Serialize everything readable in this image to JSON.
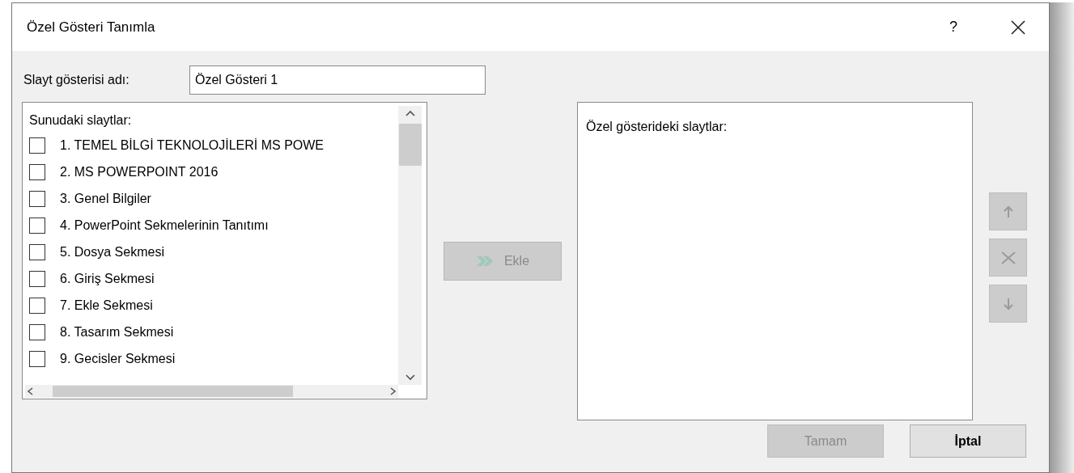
{
  "window": {
    "title": "Özel Gösteri Tanımla",
    "help": "?"
  },
  "name_field": {
    "label": "Slayt gösterisi adı:",
    "value": "Özel Gösteri 1"
  },
  "slides_list": {
    "title": "Sunudaki slaytlar:",
    "items": [
      {
        "label": "1. TEMEL BİLGİ TEKNOLOJİLERİ  MS POWE",
        "checked": false
      },
      {
        "label": "2. MS POWERPOINT 2016",
        "checked": false
      },
      {
        "label": "3. Genel Bilgiler",
        "checked": false
      },
      {
        "label": "4. PowerPoint Sekmelerinin Tanıtımı",
        "checked": false
      },
      {
        "label": "5. Dosya Sekmesi",
        "checked": false
      },
      {
        "label": "6. Giriş Sekmesi",
        "checked": false
      },
      {
        "label": "7. Ekle Sekmesi",
        "checked": false
      },
      {
        "label": "8. Tasarım Sekmesi",
        "checked": false
      },
      {
        "label": "9. Gecisler Sekmesi",
        "checked": false
      }
    ]
  },
  "add_button": {
    "label": "Ekle",
    "disabled": true
  },
  "show_list": {
    "title": "Özel gösterideki slaytlar:"
  },
  "side_buttons": [
    {
      "kind": "up",
      "disabled": true
    },
    {
      "kind": "remove",
      "disabled": true
    },
    {
      "kind": "down",
      "disabled": true
    }
  ],
  "buttons": [
    {
      "label": "Tamam",
      "disabled": true
    },
    {
      "label": "İptal",
      "disabled": false
    }
  ]
}
